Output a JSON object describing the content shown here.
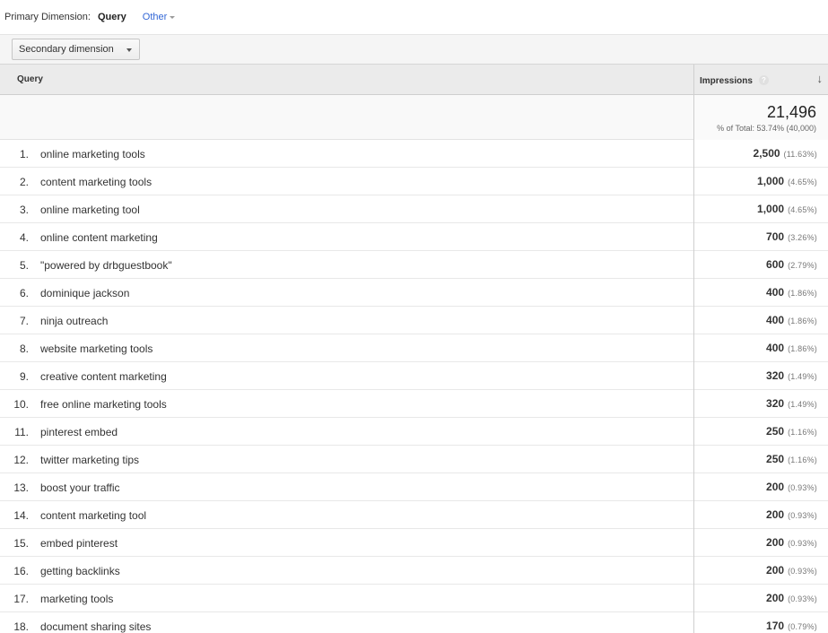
{
  "primary_dimension": {
    "label": "Primary Dimension:",
    "value": "Query",
    "other_label": "Other"
  },
  "toolbar": {
    "secondary_dimension_label": "Secondary dimension"
  },
  "table": {
    "columns": {
      "query": "Query",
      "impressions": "Impressions",
      "help": "?",
      "sort": "↓"
    },
    "totals": {
      "impressions": "21,496",
      "percent_of_total": "% of Total: 53.74% (40,000)"
    },
    "rows": [
      {
        "rank": "1.",
        "query": "online marketing tools",
        "impressions": "2,500",
        "pct": "(11.63%)"
      },
      {
        "rank": "2.",
        "query": "content marketing tools",
        "impressions": "1,000",
        "pct": "(4.65%)"
      },
      {
        "rank": "3.",
        "query": "online marketing tool",
        "impressions": "1,000",
        "pct": "(4.65%)"
      },
      {
        "rank": "4.",
        "query": "online content marketing",
        "impressions": "700",
        "pct": "(3.26%)"
      },
      {
        "rank": "5.",
        "query": "\"powered by drbguestbook\"",
        "impressions": "600",
        "pct": "(2.79%)"
      },
      {
        "rank": "6.",
        "query": "dominique jackson",
        "impressions": "400",
        "pct": "(1.86%)"
      },
      {
        "rank": "7.",
        "query": "ninja outreach",
        "impressions": "400",
        "pct": "(1.86%)"
      },
      {
        "rank": "8.",
        "query": "website marketing tools",
        "impressions": "400",
        "pct": "(1.86%)"
      },
      {
        "rank": "9.",
        "query": "creative content marketing",
        "impressions": "320",
        "pct": "(1.49%)"
      },
      {
        "rank": "10.",
        "query": "free online marketing tools",
        "impressions": "320",
        "pct": "(1.49%)"
      },
      {
        "rank": "11.",
        "query": "pinterest embed",
        "impressions": "250",
        "pct": "(1.16%)"
      },
      {
        "rank": "12.",
        "query": "twitter marketing tips",
        "impressions": "250",
        "pct": "(1.16%)"
      },
      {
        "rank": "13.",
        "query": "boost your traffic",
        "impressions": "200",
        "pct": "(0.93%)"
      },
      {
        "rank": "14.",
        "query": "content marketing tool",
        "impressions": "200",
        "pct": "(0.93%)"
      },
      {
        "rank": "15.",
        "query": "embed pinterest",
        "impressions": "200",
        "pct": "(0.93%)"
      },
      {
        "rank": "16.",
        "query": "getting backlinks",
        "impressions": "200",
        "pct": "(0.93%)"
      },
      {
        "rank": "17.",
        "query": "marketing tools",
        "impressions": "200",
        "pct": "(0.93%)"
      },
      {
        "rank": "18.",
        "query": "document sharing sites",
        "impressions": "170",
        "pct": "(0.79%)"
      }
    ]
  }
}
